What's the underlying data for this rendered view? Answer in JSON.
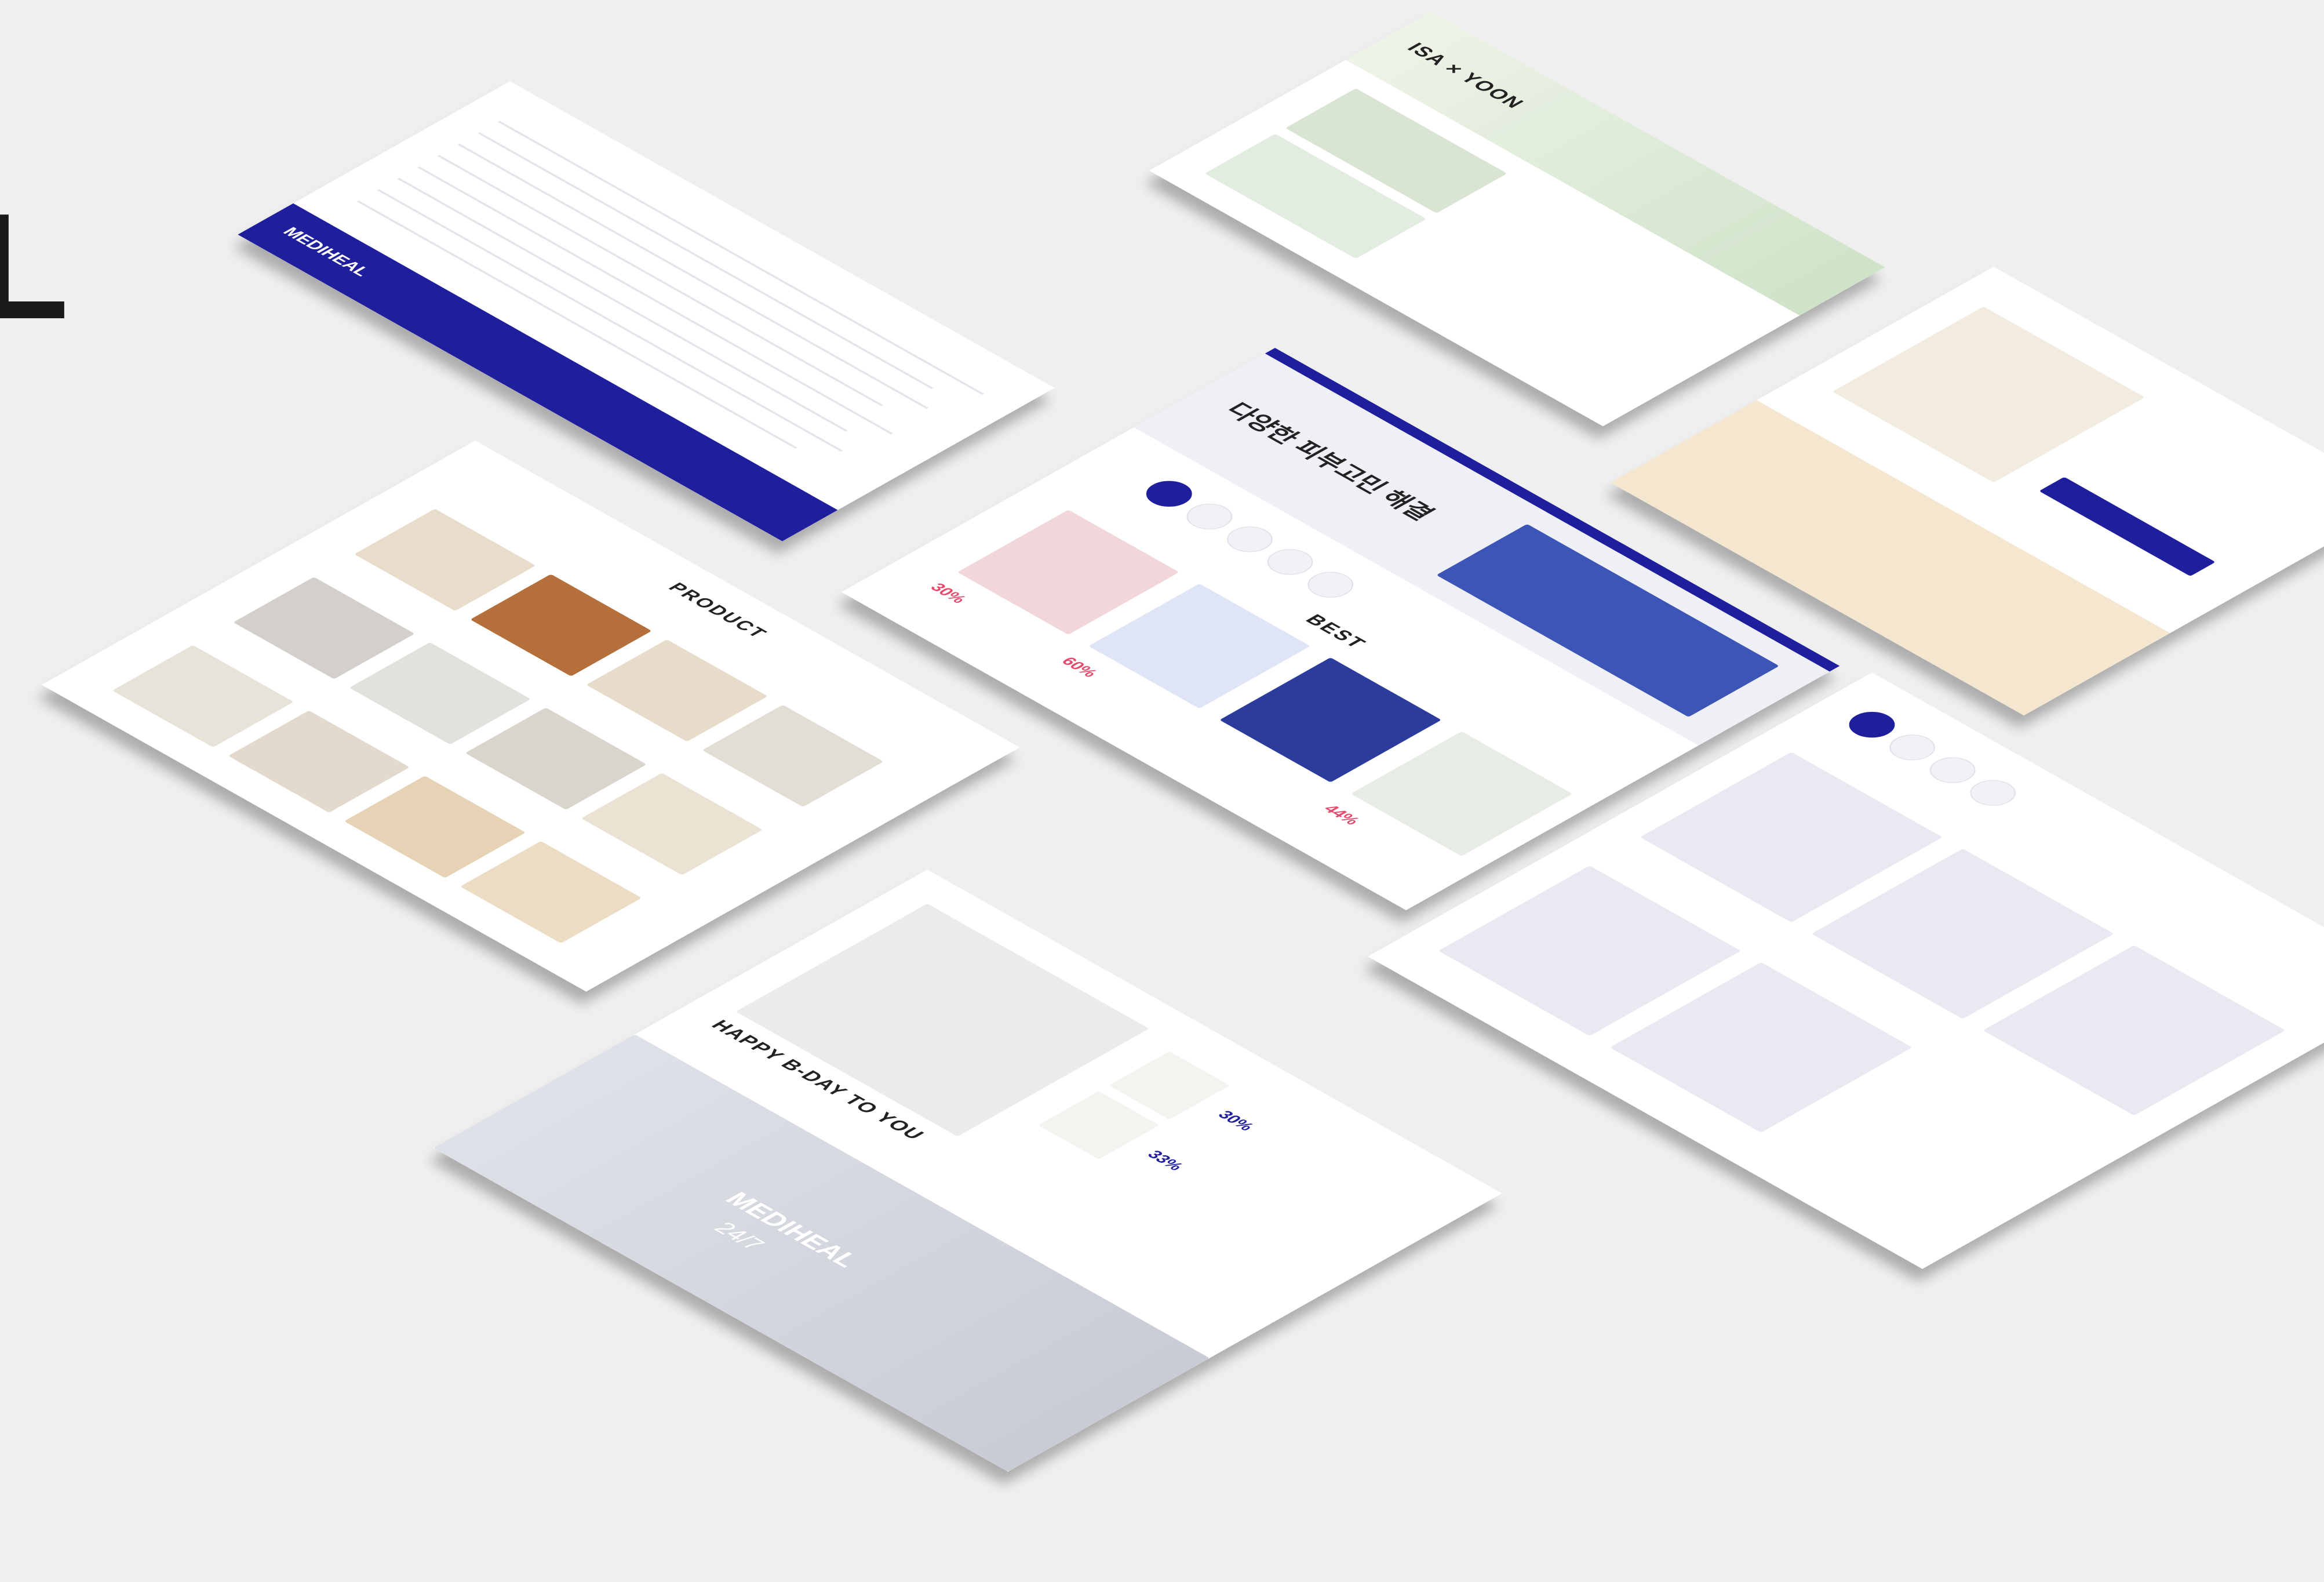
{
  "brand": {
    "partial_letter": "L",
    "name": "MEDIHEAL"
  },
  "cards": {
    "product_list": {
      "heading": "PRODUCT"
    },
    "main_hero": {
      "headline": "다양한 피부고민 해결",
      "best_heading": "BEST",
      "discount_1": "30%",
      "discount_2": "60%",
      "discount_3": "44%"
    },
    "isa_yoon": {
      "title_left": "ISA",
      "title_right": "YOON"
    },
    "birthday": {
      "headline": "HAPPY B-DAY TO YOU",
      "discount_1": "30%",
      "discount_2": "33%"
    },
    "footer": {
      "logo": "MEDIHEAL"
    },
    "packshot": {
      "brand_text": "MEDIHEAL",
      "number_text": "24/7"
    }
  },
  "colors": {
    "navy": "#1f1f9e",
    "background": "#efefef",
    "accent_red": "#e44a6b"
  }
}
